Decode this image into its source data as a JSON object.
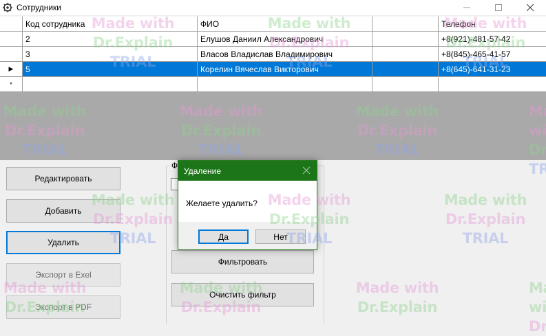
{
  "window": {
    "title": "Сотрудники",
    "app_icon": "gear-icon",
    "minimize_icon": "minimize-icon",
    "maximize_icon": "maximize-icon",
    "close_icon": "close-icon"
  },
  "grid": {
    "columns": [
      "Код сотрудника",
      "ФИО",
      "",
      "Телефон",
      ""
    ],
    "rows": [
      {
        "indicator": "",
        "id": "2",
        "fio": "Елушов Даниил Александрович",
        "phone": "+8(921)-481-57-42"
      },
      {
        "indicator": "",
        "id": "3",
        "fio": "Власов Владислав Владимирович",
        "phone": "+8(845)-465-41-57"
      },
      {
        "indicator": "▶",
        "id": "5",
        "fio": "Корелин Вячеслав Викторович",
        "phone": "+8(645)-641-31-23",
        "selected": true
      }
    ],
    "new_row_indicator": "*"
  },
  "actions": {
    "edit": "Редактировать",
    "add": "Добавить",
    "delete": "Удалить",
    "export_excel": "Экспорт в Exel",
    "export_pdf": "Экспорт в PDF"
  },
  "filter": {
    "group_label": "Ф",
    "apply": "Фильтровать",
    "clear": "Очистить фильтр"
  },
  "dialog": {
    "title": "Удаление",
    "message": "Желаете удалить?",
    "yes": "Да",
    "no": "Нет",
    "title_color": "#1d7519"
  },
  "watermark": {
    "line1": "Made with",
    "line2": "Dr.Explain",
    "line3": "TRIAL"
  },
  "colors": {
    "selection": "#0078d7",
    "band": "#a9a9a9",
    "wm1": "#e59ad6",
    "wm2": "#8fd38f",
    "wm3": "#8fa6e8"
  }
}
